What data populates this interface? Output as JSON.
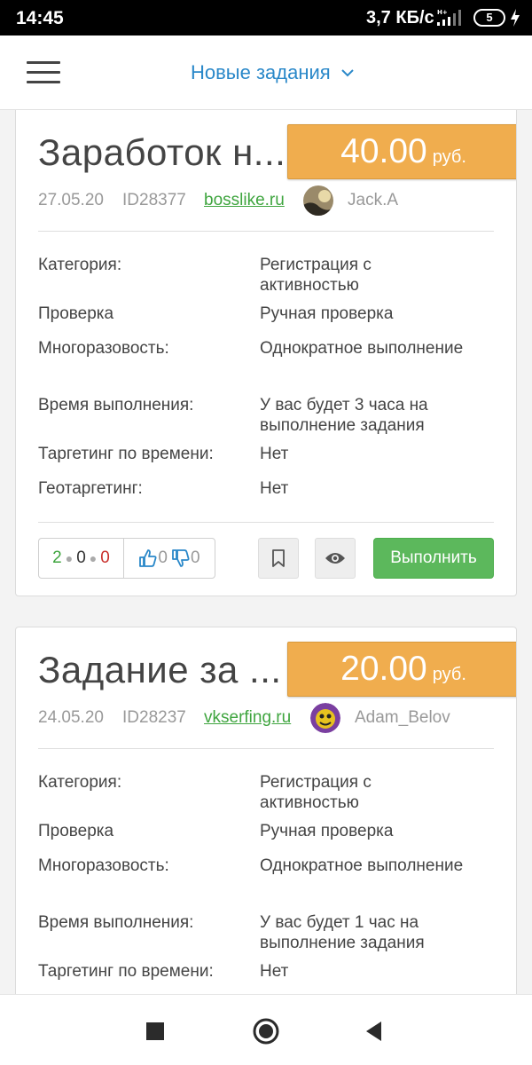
{
  "status": {
    "time": "14:45",
    "speed": "3,7 КБ/с",
    "battery": "5"
  },
  "header": {
    "title": "Новые задания",
    "menu_icon": "hamburger-icon",
    "dropdown_icon": "chevron-down-icon"
  },
  "tasks": [
    {
      "title": "Заработок н...",
      "price": "40.00",
      "currency": "руб.",
      "date": "27.05.20",
      "id": "ID28377",
      "site": "bosslike.ru",
      "user": "Jack.A",
      "details": [
        {
          "label": "Категория:",
          "value": "Регистрация с активностью"
        },
        {
          "label": "Проверка",
          "value": "Ручная проверка"
        },
        {
          "label": "Многоразовость:",
          "value": "Однократное выполнение"
        },
        {
          "label": "Время выполнения:",
          "value": "У вас будет 3 часа на выполнение задания"
        },
        {
          "label": "Таргетинг по времени:",
          "value": "Нет"
        },
        {
          "label": "Геотаргетинг:",
          "value": "Нет"
        }
      ],
      "stats": {
        "done": "2",
        "pending": "0",
        "rejected": "0",
        "likes": "0",
        "dislikes": "0"
      },
      "action_label": "Выполнить"
    },
    {
      "title": "Задание за ...",
      "price": "20.00",
      "currency": "руб.",
      "date": "24.05.20",
      "id": "ID28237",
      "site": "vkserfing.ru",
      "user": "Adam_Belov",
      "details": [
        {
          "label": "Категория:",
          "value": "Регистрация с активностью"
        },
        {
          "label": "Проверка",
          "value": "Ручная проверка"
        },
        {
          "label": "Многоразовость:",
          "value": "Однократное выполнение"
        },
        {
          "label": "Время выполнения:",
          "value": "У вас будет 1 час на выполнение задания"
        },
        {
          "label": "Таргетинг по времени:",
          "value": "Нет"
        }
      ]
    }
  ],
  "colors": {
    "accent_blue": "#2a88c9",
    "price_orange": "#f0ad4e",
    "success_green": "#5cb85c",
    "danger_red": "#c9302c"
  }
}
